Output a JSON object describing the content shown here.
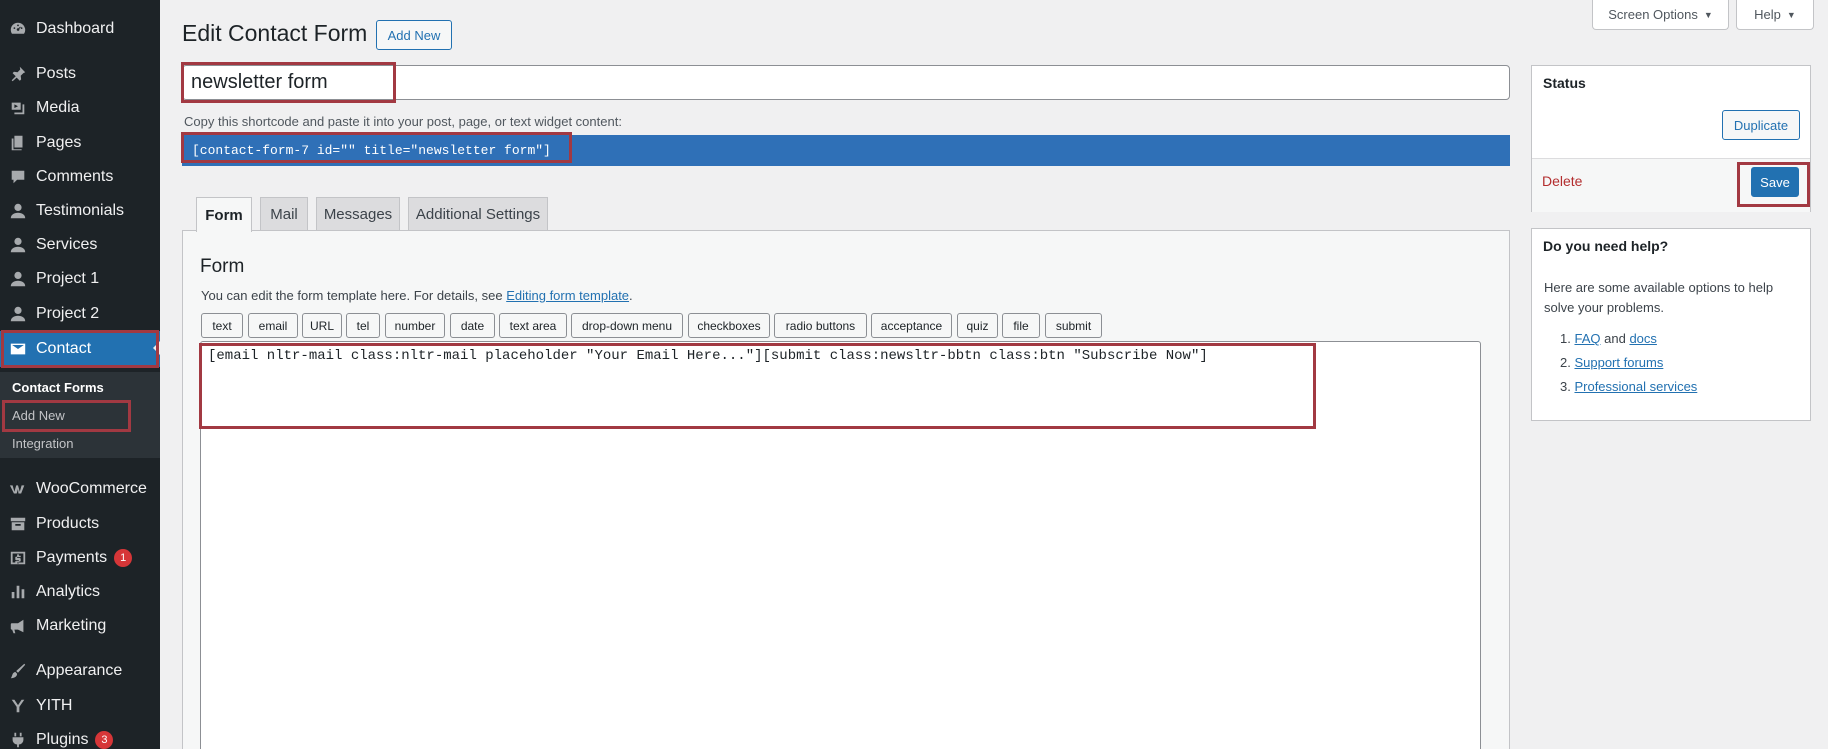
{
  "sidebar": {
    "items": [
      {
        "label": "Dashboard",
        "icon": "dashboard-icon"
      },
      {
        "label": "Posts",
        "icon": "pushpin-icon"
      },
      {
        "label": "Media",
        "icon": "media-icon"
      },
      {
        "label": "Pages",
        "icon": "pages-icon"
      },
      {
        "label": "Comments",
        "icon": "comment-icon"
      },
      {
        "label": "Testimonials",
        "icon": "person-icon"
      },
      {
        "label": "Services",
        "icon": "person-icon"
      },
      {
        "label": "Project 1",
        "icon": "person-icon"
      },
      {
        "label": "Project 2",
        "icon": "person-icon"
      },
      {
        "label": "Contact",
        "icon": "envelope-icon"
      },
      {
        "label": "WooCommerce",
        "icon": "woo-icon"
      },
      {
        "label": "Products",
        "icon": "archive-icon"
      },
      {
        "label": "Payments",
        "icon": "dollar-icon",
        "badge": "1"
      },
      {
        "label": "Analytics",
        "icon": "bar-chart-icon"
      },
      {
        "label": "Marketing",
        "icon": "megaphone-icon"
      },
      {
        "label": "Appearance",
        "icon": "paintbrush-icon"
      },
      {
        "label": "YITH",
        "icon": "yith-icon"
      },
      {
        "label": "Plugins",
        "icon": "plug-icon",
        "badge": "3"
      }
    ],
    "submenu": [
      "Contact Forms",
      "Add New",
      "Integration"
    ]
  },
  "header": {
    "title": "Edit Contact Form",
    "add_new": "Add New",
    "screen_options": "Screen Options",
    "help": "Help"
  },
  "form_title": "newsletter form",
  "shortcode": {
    "hint": "Copy this shortcode and paste it into your post, page, or text widget content:",
    "code": "[contact-form-7 id=\"\" title=\"newsletter form\"]"
  },
  "tabs": [
    "Form",
    "Mail",
    "Messages",
    "Additional Settings"
  ],
  "form_panel": {
    "title": "Form",
    "hint_prefix": "You can edit the form template here. For details, see ",
    "hint_link": "Editing form template",
    "hint_suffix": ".",
    "tag_buttons": [
      "text",
      "email",
      "URL",
      "tel",
      "number",
      "date",
      "text area",
      "drop-down menu",
      "checkboxes",
      "radio buttons",
      "acceptance",
      "quiz",
      "file",
      "submit"
    ],
    "template": "[email nltr-mail class:nltr-mail placeholder \"Your Email Here...\"][submit class:newsltr-bbtn class:btn \"Subscribe Now\"]"
  },
  "status_box": {
    "title": "Status",
    "duplicate": "Duplicate",
    "delete": "Delete",
    "save": "Save"
  },
  "help_box": {
    "title": "Do you need help?",
    "text": "Here are some available options to help solve your problems.",
    "faq": "FAQ",
    "and": "and",
    "docs": "docs",
    "support": "Support forums",
    "professional": "Professional services"
  },
  "colors": {
    "sidebar_bg": "#1d2327",
    "accent": "#2271b1",
    "highlight": "#a23942",
    "badge": "#d63638"
  }
}
